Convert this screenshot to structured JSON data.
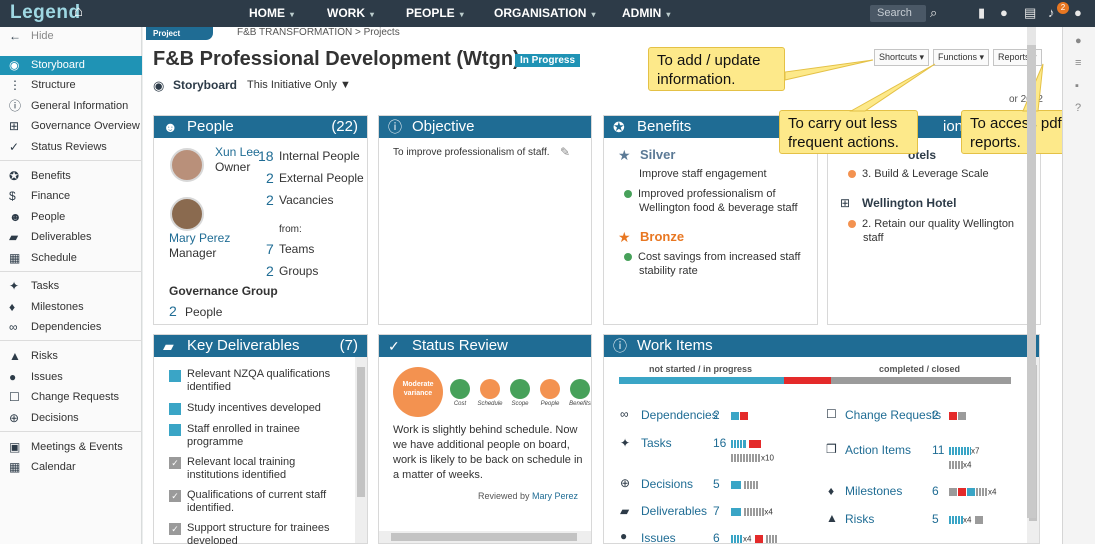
{
  "brand": {
    "logo": "Legend"
  },
  "topnav": {
    "items": [
      {
        "label": "HOME"
      },
      {
        "label": "WORK"
      },
      {
        "label": "PEOPLE"
      },
      {
        "label": "ORGANISATION"
      },
      {
        "label": "ADMIN"
      }
    ],
    "search_placeholder": "Search",
    "notifications": "2"
  },
  "sidebar": {
    "hide": "Hide",
    "items": [
      {
        "label": "Storyboard"
      },
      {
        "label": "Structure"
      },
      {
        "label": "General Information"
      },
      {
        "label": "Governance Overview"
      },
      {
        "label": "Status Reviews"
      },
      {
        "label": "Benefits"
      },
      {
        "label": "Finance"
      },
      {
        "label": "People"
      },
      {
        "label": "Deliverables"
      },
      {
        "label": "Schedule"
      },
      {
        "label": "Tasks"
      },
      {
        "label": "Milestones"
      },
      {
        "label": "Dependencies"
      },
      {
        "label": "Risks"
      },
      {
        "label": "Issues"
      },
      {
        "label": "Change Requests"
      },
      {
        "label": "Decisions"
      },
      {
        "label": "Meetings & Events"
      },
      {
        "label": "Calendar"
      }
    ]
  },
  "header": {
    "tag": "Project",
    "breadcrumb": "F&B TRANSFORMATION > Projects",
    "title": "F&B Professional Development (Wtgn)",
    "status": "In Progress",
    "storyboard": "Storyboard",
    "initiative": "This Initiative Only",
    "date_fragment": "or 2022"
  },
  "toolbar": {
    "shortcuts": "Shortcuts",
    "functions": "Functions",
    "reports": "Reports"
  },
  "callouts": {
    "add": "To add / update information.",
    "functions": "To carry out less frequent actions.",
    "reports": "To access pdf reports."
  },
  "people": {
    "title": "People",
    "count": "(22)",
    "owner_name": "Xun Lee",
    "owner_role": "Owner",
    "manager_name": "Mary Perez",
    "manager_role": "Manager",
    "internal_num": "18",
    "internal_lbl": "Internal People",
    "external_num": "2",
    "external_lbl": "External People",
    "vacancies_num": "2",
    "vacancies_lbl": "Vacancies",
    "from": "from:",
    "teams_num": "7",
    "teams_lbl": "Teams",
    "groups_num": "2",
    "groups_lbl": "Groups",
    "gov_title": "Governance Group",
    "gov_num": "2",
    "gov_lbl": "People"
  },
  "objective": {
    "title": "Objective",
    "text": "To improve professionalism of staff."
  },
  "benefits": {
    "title": "Benefits",
    "silver": "Silver",
    "silver_items": [
      "Improve staff engagement",
      "Improved professionalism of Wellington food & beverage staff"
    ],
    "bronze": "Bronze",
    "bronze_items": [
      "Cost savings from increased staff stability rate"
    ]
  },
  "contribution": {
    "title_fragment": "ion to",
    "hotels_fragment": "otels",
    "item1": "3. Build & Leverage Scale",
    "hotel": "Wellington Hotel",
    "item2": "2. Retain our quality Wellington staff"
  },
  "deliverables": {
    "title": "Key Deliverables",
    "count": "(7)",
    "items": [
      "Relevant NZQA qualifications identified",
      "Study incentives developed",
      "Staff enrolled in trainee programme",
      "Relevant local training institutions identified",
      "Qualifications of current staff identified.",
      "Support structure for trainees developed"
    ]
  },
  "status_review": {
    "title": "Status Review",
    "overall": "Moderate variance",
    "dims": [
      "Cost",
      "Schedule",
      "Scope",
      "People",
      "Benefits"
    ],
    "dim_colors": [
      "#47a15a",
      "#f39250",
      "#47a15a",
      "#f39250",
      "#47a15a"
    ],
    "text": "Work is slightly behind schedule. Now we have additional people on board, work is likely to be back on schedule in a matter of weeks.",
    "reviewed_by": "Reviewed by",
    "reviewer": "Mary Perez"
  },
  "work_items": {
    "title": "Work Items",
    "left_hdr": "not started / in progress",
    "right_hdr": "completed / closed",
    "progress": {
      "in_progress": 0.42,
      "red": 0.12,
      "completed": 0.46
    },
    "left": [
      {
        "label": "Dependencies",
        "count": "2"
      },
      {
        "label": "Tasks",
        "count": "16",
        "x1": "x10"
      },
      {
        "label": "Decisions",
        "count": "5"
      },
      {
        "label": "Deliverables",
        "count": "7",
        "x1": "x4"
      },
      {
        "label": "Issues",
        "count": "6",
        "x1": "x4"
      }
    ],
    "right": [
      {
        "label": "Change Requests",
        "count": "2"
      },
      {
        "label": "Action Items",
        "count": "11",
        "x1": "x7",
        "x2": "x4"
      },
      {
        "label": "Milestones",
        "count": "6",
        "x1": "x4"
      },
      {
        "label": "Risks",
        "count": "5",
        "x1": "x4"
      }
    ]
  },
  "colors": {
    "header_bg": "#2d3b48",
    "accent": "#1f93b5",
    "panel_header": "#1f6c94",
    "callout": "#fde98a"
  }
}
